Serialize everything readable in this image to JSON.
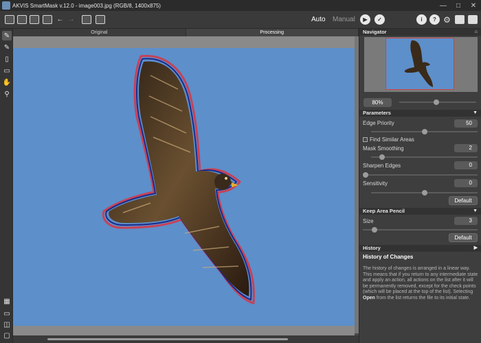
{
  "window": {
    "title": "AKVIS SmartMask v.12.0 - image003.jpg (RGB/8, 1400x875)"
  },
  "toolbar": {
    "mode_auto": "Auto",
    "mode_manual": "Manual",
    "help_label": "?",
    "info_label": "i"
  },
  "tabs": [
    "Original",
    "Processing"
  ],
  "panel": {
    "navigator_title": "Navigator",
    "zoom": "80%",
    "parameters_title": "Parameters",
    "params": [
      {
        "label": "Edge Priority",
        "value": "50",
        "fraction": 0.5
      },
      {
        "label": "Mask Smoothing",
        "value": "2",
        "fraction": 0.1
      },
      {
        "label": "Sharpen Edges",
        "value": "0",
        "fraction": 0.0
      },
      {
        "label": "Sensitivity",
        "value": "0",
        "fraction": 0.5
      }
    ],
    "find_similar": "Find Similar Areas",
    "default_label": "Default",
    "keep_area_title": "Keep Area Pencil",
    "size_label": "Size",
    "size_value": "3",
    "size_fraction": 0.1,
    "history_title": "History",
    "history_heading": "History of Changes",
    "history_text_1": "The history of changes is arranged in a linear way. This means that if you return to any intermediate state and apply an action, all actions on the list after it will be permanently removed, except for the check points (which will be placed at the top of the list). Selecting ",
    "history_bold": "Open",
    "history_text_2": " from the list returns the file to its initial state."
  },
  "colors": {
    "sky": "#5d8fca",
    "mask_outline_red": "#d23a4a",
    "mask_outline_blue": "#1a2a8a"
  }
}
